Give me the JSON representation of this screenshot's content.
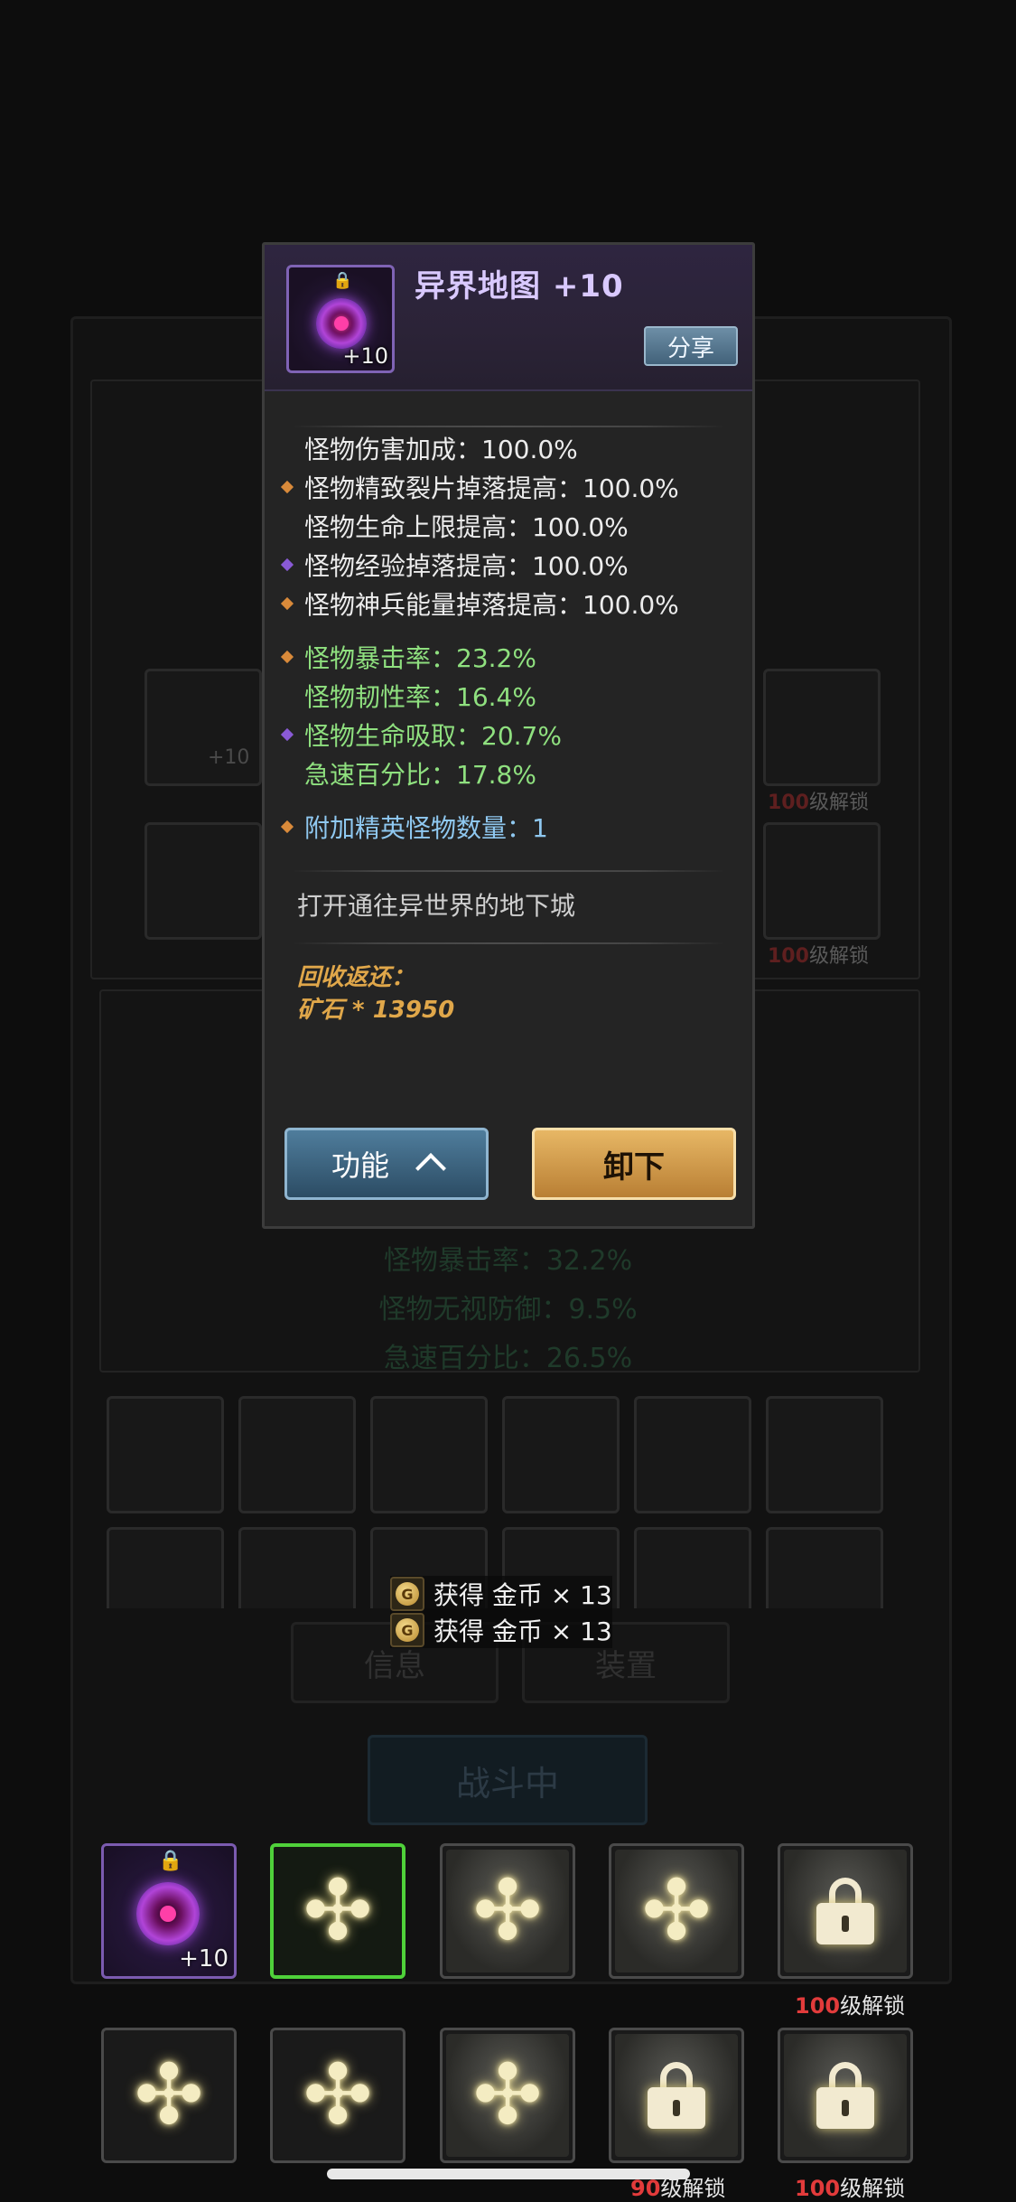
{
  "background": {
    "dim_stats": [
      "怪物暴击率：32.2%",
      "怪物无视防御：9.5%",
      "急速百分比：26.5%"
    ],
    "tabs": [
      "信息",
      "装置"
    ],
    "battle_status": "战斗中",
    "side_unlock_labels": [
      {
        "level": "100",
        "suffix": "级解锁"
      },
      {
        "level": "100",
        "suffix": "级解锁"
      }
    ],
    "side_item_plus": "+10"
  },
  "popup": {
    "title": "异界地图 +10",
    "item_plus": "+10",
    "share_label": "分享",
    "stats_white": [
      {
        "text": "怪物伤害加成：100.0%",
        "marker": "none"
      },
      {
        "text": "怪物精致裂片掉落提高：100.0%",
        "marker": "orange"
      },
      {
        "text": "怪物生命上限提高：100.0%",
        "marker": "none"
      },
      {
        "text": "怪物经验掉落提高：100.0%",
        "marker": "purple"
      },
      {
        "text": "怪物神兵能量掉落提高：100.0%",
        "marker": "orange"
      }
    ],
    "stats_green": [
      {
        "text": "怪物暴击率：23.2%",
        "marker": "orange"
      },
      {
        "text": "怪物韧性率：16.4%",
        "marker": "none"
      },
      {
        "text": "怪物生命吸取：20.7%",
        "marker": "purple"
      },
      {
        "text": "急速百分比：17.8%",
        "marker": "none"
      }
    ],
    "stat_blue": {
      "text": "附加精英怪物数量：1",
      "marker": "orange"
    },
    "description": "打开通往异世界的地下城",
    "recycle_title": "回收返还：",
    "recycle_value": "矿石 * 13950",
    "function_label": "功能",
    "unequip_label": "卸下"
  },
  "toasts": [
    {
      "coin_symbol": "G",
      "text": "获得 金币 × 13"
    },
    {
      "coin_symbol": "G",
      "text": "获得 金币 × 13"
    }
  ],
  "equipment": {
    "row1_first_plus": "+10",
    "row1_unlock": {
      "level": "100",
      "suffix": "级解锁"
    },
    "row2_unlock_a": {
      "level": "90",
      "suffix": "级解锁"
    },
    "row2_unlock_b": {
      "level": "100",
      "suffix": "级解锁"
    }
  },
  "icons": {
    "cross": "✣",
    "lock": "🔒"
  },
  "colors": {
    "title": "#d9c9ff",
    "green_stat": "#8fe07f",
    "blue_stat": "#8fc8f0",
    "recycle": "#e0a74a",
    "selected_slot": "#4fd13a",
    "unlock_level": "#e23b3b"
  }
}
